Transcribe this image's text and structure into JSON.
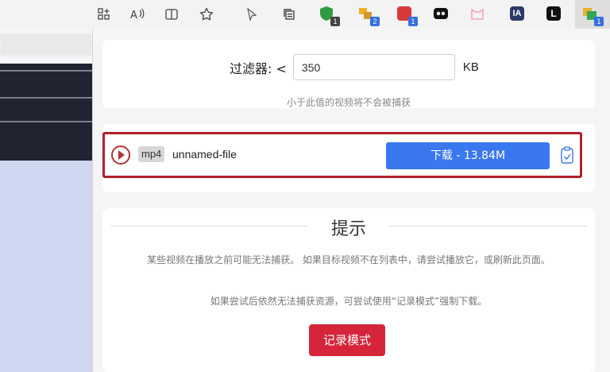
{
  "toolbar": {
    "icons": [
      "grid-icon",
      "read-aloud-icon",
      "split-screen-icon",
      "favorite-star-icon",
      "cursor-icon",
      "collections-icon"
    ],
    "extensions": [
      {
        "name": "shield-extension-icon",
        "color": "#2e9b3f",
        "badge": "1",
        "badge_color": "#444444"
      },
      {
        "name": "coupon-extension-icon",
        "color": "#e8b22a",
        "badge": "2",
        "badge_color": "#3570e0"
      },
      {
        "name": "red-extension-icon",
        "color": "#d83a3a",
        "badge": "1",
        "badge_color": "#3570e0"
      },
      {
        "name": "mask-extension-icon",
        "color": "#111111",
        "badge": "",
        "badge_color": ""
      },
      {
        "name": "cat-extension-icon",
        "color": "#f2a6bd",
        "badge": "",
        "badge_color": ""
      },
      {
        "name": "ia-extension-icon",
        "color": "#2a3a6b",
        "badge": "",
        "badge_color": "",
        "text": "IA"
      },
      {
        "name": "l-extension-icon",
        "color": "#111111",
        "badge": "",
        "badge_color": "",
        "text": "L"
      },
      {
        "name": "cat-catch-extension-icon",
        "color": "#33a852",
        "badge": "1",
        "badge_color": "#3570e0"
      }
    ]
  },
  "filter": {
    "label": "过滤器: <",
    "value": "350",
    "unit": "KB",
    "hint": "小于此值的视频将不会被捕获"
  },
  "video": {
    "format": "mp4",
    "filename": "unnamed-file",
    "download_label": "下载 - 13.84M"
  },
  "tips": {
    "title": "提示",
    "paragraph1": "某些视频在播放之前可能无法捕获。 如果目标视频不在列表中，请尝试播放它，或刷新此页面。",
    "paragraph2": "如果尝试后依然无法捕获资源，可尝试使用“记录模式”强制下载。",
    "record_button": "记录模式"
  }
}
